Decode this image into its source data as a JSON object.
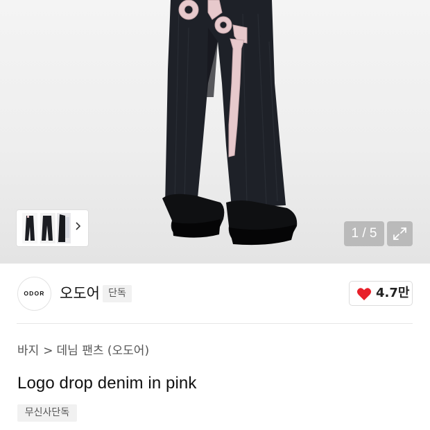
{
  "gallery": {
    "counter": "1 / 5",
    "thumbnail_alt_icon": "product-thumbnails",
    "pants_logo_text": "ODOR",
    "hero_label": "product-photo-denim-pants"
  },
  "brand": {
    "logo_text": "ODOR",
    "name": "오도어",
    "exclusive_badge": "단독"
  },
  "like": {
    "count": "4.7만",
    "color": "#e8202a"
  },
  "breadcrumb": {
    "category": "바지",
    "separator": ">",
    "subcategory": "데님 팬츠 (오도어)"
  },
  "product": {
    "title": "Logo drop denim in pink",
    "tag": "무신사단독"
  }
}
